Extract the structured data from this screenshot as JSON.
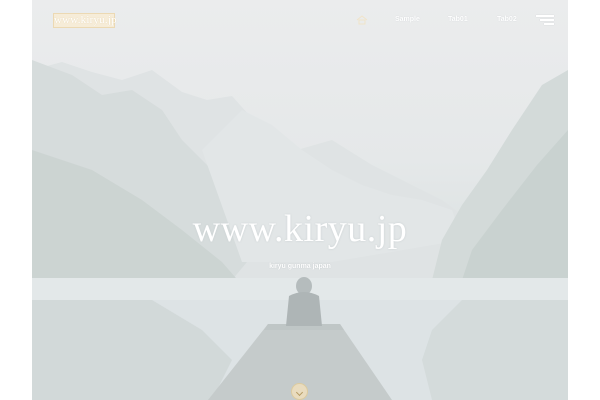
{
  "header": {
    "logo_text": "www.kiryu.jp",
    "nav": [
      {
        "label": "Sample"
      },
      {
        "label": "Tab01"
      },
      {
        "label": "Tab02"
      }
    ],
    "home_icon": "home-icon",
    "menu_icon": "hamburger-menu-icon"
  },
  "hero": {
    "title": "www.kiryu.jp",
    "subtitle": "kiryu gunma japan",
    "scroll_icon": "chevron-down-icon"
  },
  "colors": {
    "accent": "#f6ecd8",
    "accent_border": "#ecd9b3",
    "hero_tint": "#e5e8e9",
    "text": "#ffffff"
  }
}
